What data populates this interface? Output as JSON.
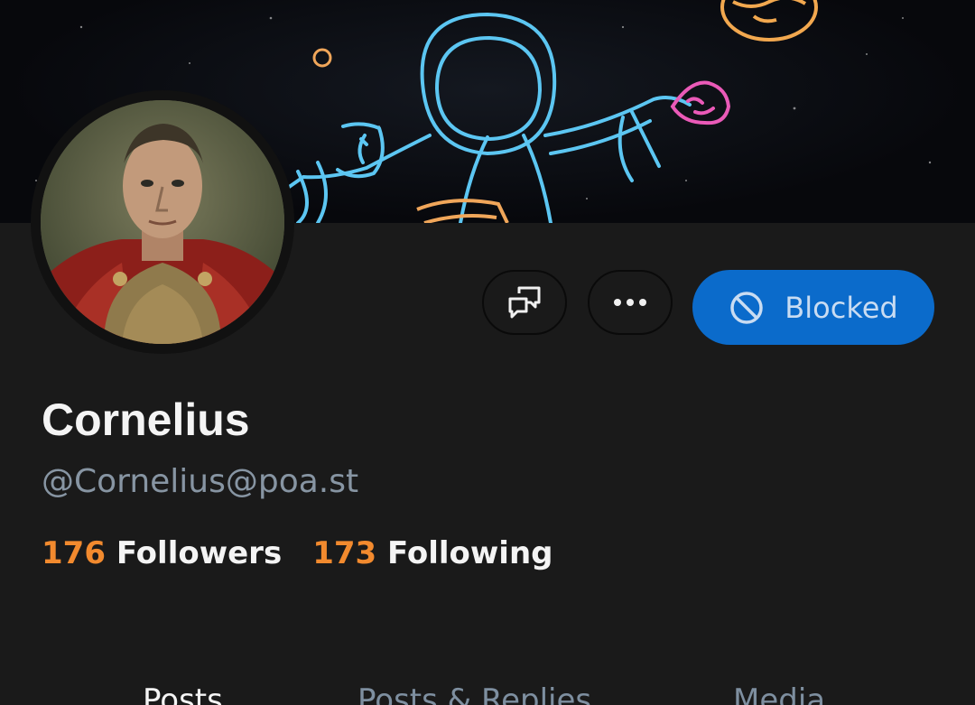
{
  "profile": {
    "display_name": "Cornelius",
    "handle": "@Cornelius@poa.st",
    "followers_count": "176",
    "followers_label": "Followers",
    "following_count": "173",
    "following_label": "Following"
  },
  "actions": {
    "chat_icon": "chat-bubbles-icon",
    "more_icon": "ellipsis-icon",
    "blocked_label": "Blocked",
    "blocked_icon": "block-icon"
  },
  "tabs": [
    {
      "label": "Posts",
      "active": true
    },
    {
      "label": "Posts & Replies",
      "active": false
    },
    {
      "label": "Media",
      "active": false
    }
  ],
  "colors": {
    "background": "#1a1a1a",
    "accent": "#0b6bcb",
    "stat_number": "#f28a2e",
    "muted_text": "#8795a3"
  }
}
